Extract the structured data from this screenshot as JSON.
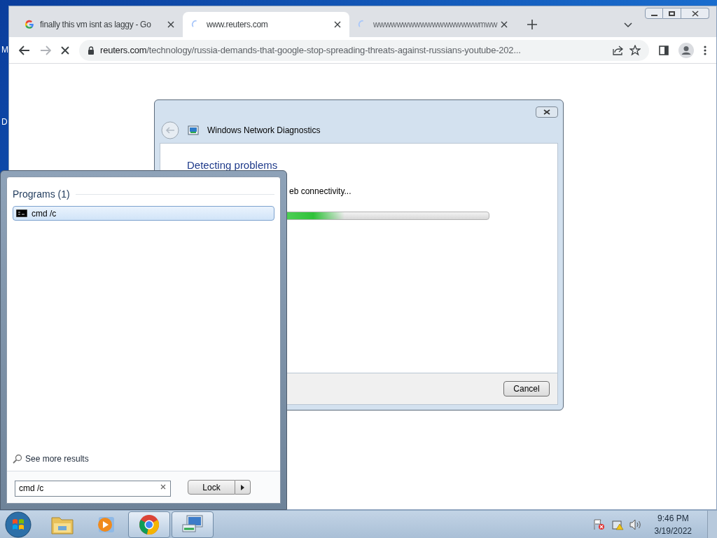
{
  "desktop": {
    "icon_labels": [
      "M",
      "D"
    ]
  },
  "browser": {
    "tabs": [
      {
        "kind": "google",
        "title": "finally this vm isnt as laggy - Go",
        "selected": false
      },
      {
        "kind": "loading",
        "title": "www.reuters.com",
        "selected": true
      },
      {
        "kind": "loading",
        "title": "wwwwwwwwwwwwwwwwwwmww",
        "selected": false
      }
    ],
    "address": {
      "host": "reuters.com",
      "path": "/technology/russia-demands-that-google-stop-spreading-threats-against-russians-youtube-202..."
    }
  },
  "dialog": {
    "title": "Windows Network Diagnostics",
    "heading": "Detecting problems",
    "status": "eb connectivity...",
    "progress": {
      "level": 0.3
    },
    "cancel": "Cancel"
  },
  "start_menu": {
    "section": "Programs (1)",
    "results": [
      {
        "label": "cmd /c",
        "selected": true
      }
    ],
    "see_more": "See more results",
    "search": {
      "value": "cmd /c"
    },
    "power_button": "Lock"
  },
  "taskbar": {
    "apps": [
      {
        "kind": "explorer",
        "active": false
      },
      {
        "kind": "media",
        "active": false
      },
      {
        "kind": "chrome",
        "active": true
      },
      {
        "kind": "network",
        "active": true
      }
    ],
    "clock": {
      "time": "9:46 PM",
      "date": "3/19/2022"
    }
  }
}
